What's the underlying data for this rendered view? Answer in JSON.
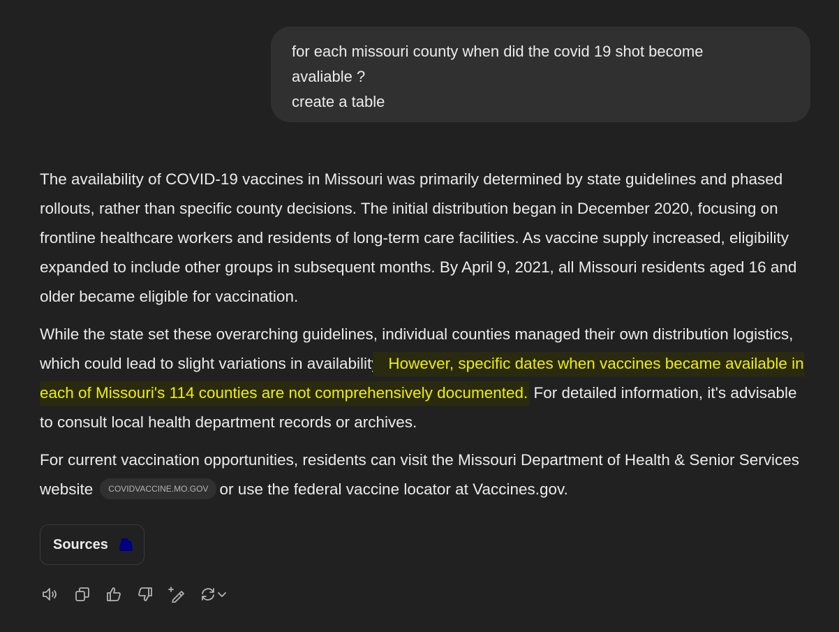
{
  "user_message": {
    "lines": [
      "for each missouri county when did the covid 19 shot become",
      "avaliable ?",
      "create a table"
    ]
  },
  "answer": {
    "p1": "The availability of COVID-19 vaccines in Missouri was primarily determined by state guidelines and phased rollouts, rather than specific county decisions. The initial distribution began in December 2020, focusing on frontline healthcare workers and residents of long-term care facilities. As vaccine supply increased, eligibility expanded to include other groups in subsequent months. By April 9, 2021, all Missouri residents aged 16 and older became eligible for vaccination.",
    "p2_before": "While the state set these overarching guidelines, individual counties managed their own distribution logistics, which could lead to slight variations in availability. ",
    "p2_highlight": "However, specific dates when vaccines became available in each of Missouri's 114 counties are not comprehensively documented.",
    "p2_after": " For detailed information, it's advisable to consult local health department records or archives.",
    "p3_before": "For current vaccination opportunities, residents can visit the Missouri Department of Health & Senior Services website",
    "p3_chip": "COVIDVACCINE.MO.GOV",
    "p3_after": "or use the federal vaccine locator at Vaccines.gov."
  },
  "sources_button": {
    "label": "Sources",
    "icon": "source-favicon-icon",
    "icon_color": "#000080"
  },
  "actions": [
    {
      "name": "read-aloud-icon"
    },
    {
      "name": "copy-icon"
    },
    {
      "name": "thumbs-up-icon"
    },
    {
      "name": "thumbs-down-icon"
    },
    {
      "name": "edit-canvas-icon"
    },
    {
      "name": "regenerate-icon"
    }
  ],
  "colors": {
    "background": "#212121",
    "bubble": "#303030",
    "text": "#ececec",
    "highlight_text": "#f0f000",
    "highlight_bg": "#2a2a10"
  }
}
